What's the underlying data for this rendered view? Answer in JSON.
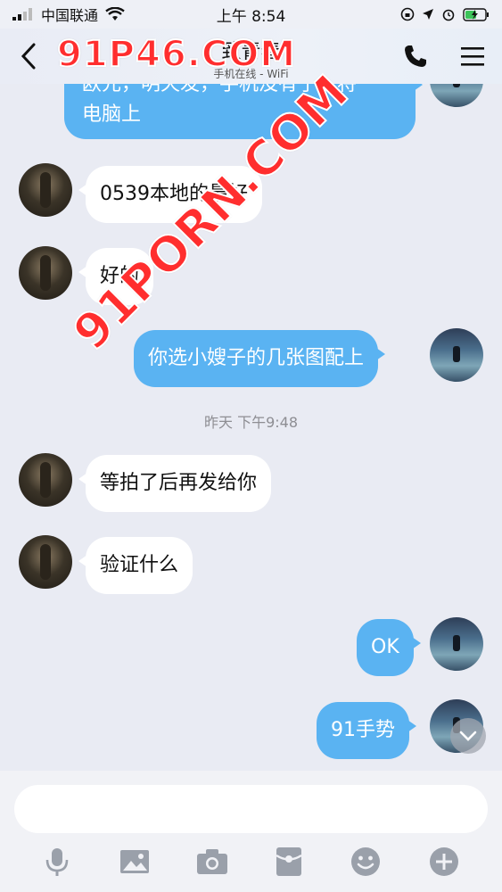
{
  "status_bar": {
    "carrier": "中国联通",
    "time": "上午 8:54"
  },
  "header": {
    "title": "致青春",
    "subtitle": "手机在线 - WiFi"
  },
  "watermarks": {
    "top": "91P46.COM",
    "diagonal": "91PORN.COM"
  },
  "messages": [
    {
      "side": "right",
      "text": "欧元，明天发，手机没有了，将\n电脑上"
    },
    {
      "side": "left",
      "text": "0539本地的最好"
    },
    {
      "side": "left",
      "text": "好的"
    },
    {
      "side": "right",
      "text": "你选小嫂子的几张图配上"
    },
    {
      "side": "left",
      "text": "等拍了后再发给你"
    },
    {
      "side": "left",
      "text": "验证什么"
    },
    {
      "side": "right",
      "text": "OK"
    },
    {
      "side": "right",
      "text": "91手势"
    }
  ],
  "time_separator": "昨天 下午9:48",
  "input": {
    "placeholder": ""
  },
  "toolbar": [
    "microphone-icon",
    "image-icon",
    "camera-icon",
    "red-packet-icon",
    "emoji-icon",
    "plus-icon"
  ],
  "colors": {
    "bubble_right": "#5ab3f2",
    "bubble_left": "#ffffff",
    "background": "#e9ebf3"
  }
}
